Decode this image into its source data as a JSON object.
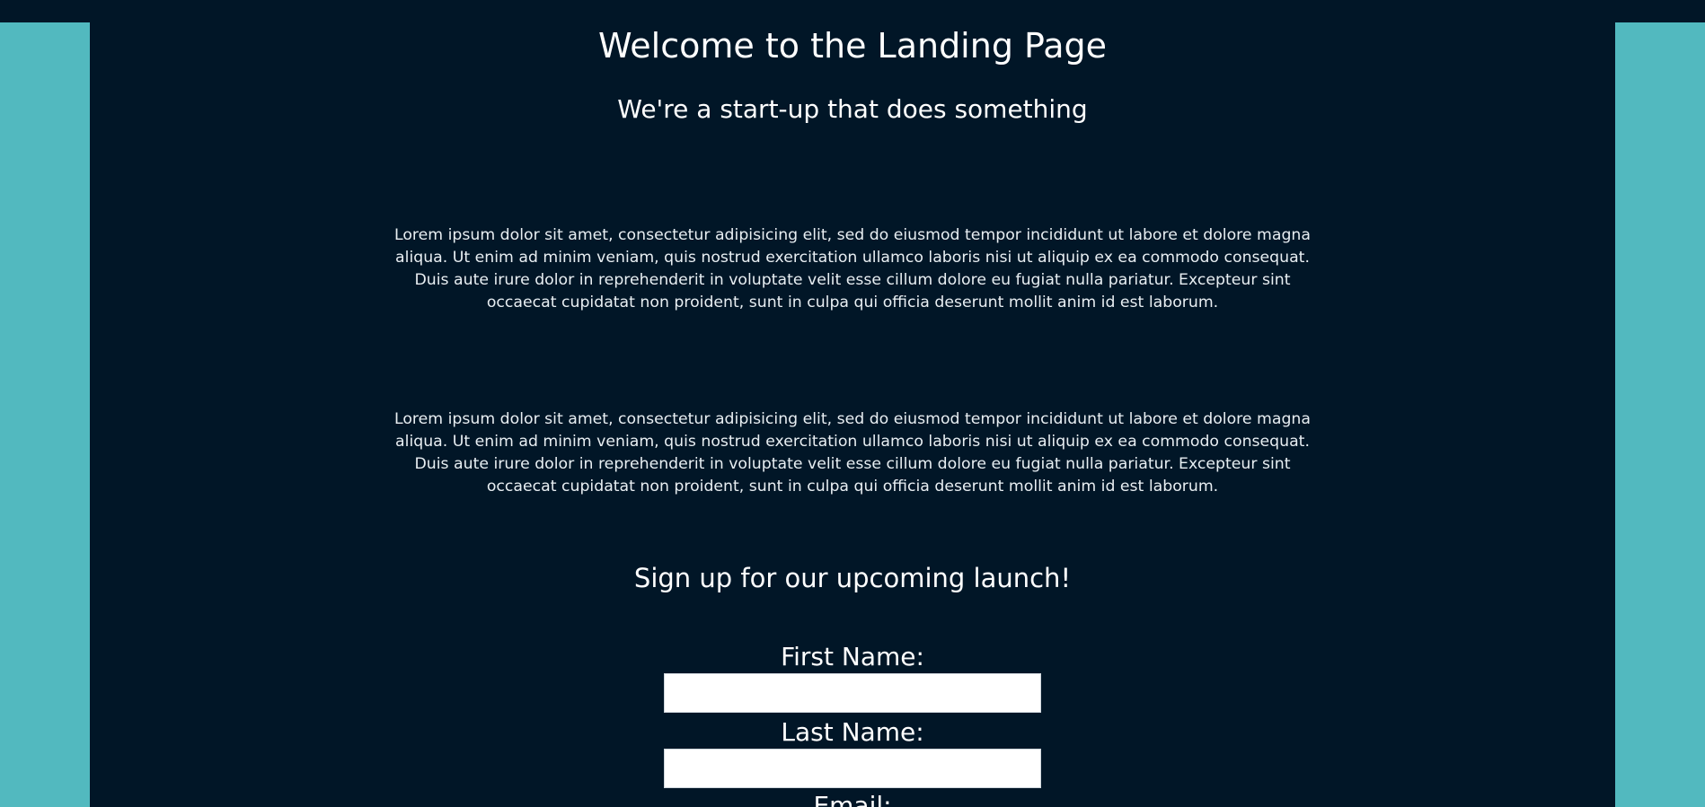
{
  "colors": {
    "background": "#011627",
    "side_panels": "#52b9bf",
    "text": "#ffffff"
  },
  "header": {
    "title": "Welcome to the Landing Page",
    "tagline": "We're a start-up that does something"
  },
  "main": {
    "paragraphs": [
      "Lorem ipsum dolor sit amet, consectetur adipisicing elit, sed do eiusmod tempor incididunt ut labore et dolore magna aliqua. Ut enim ad minim veniam, quis nostrud exercitation ullamco laboris nisi ut aliquip ex ea commodo consequat. Duis aute irure dolor in reprehenderit in voluptate velit esse cillum dolore eu fugiat nulla pariatur. Excepteur sint occaecat cupidatat non proident, sunt in culpa qui officia deserunt mollit anim id est laborum.",
      "Lorem ipsum dolor sit amet, consectetur adipisicing elit, sed do eiusmod tempor incididunt ut labore et dolore magna aliqua. Ut enim ad minim veniam, quis nostrud exercitation ullamco laboris nisi ut aliquip ex ea commodo consequat. Duis aute irure dolor in reprehenderit in voluptate velit esse cillum dolore eu fugiat nulla pariatur. Excepteur sint occaecat cupidatat non proident, sunt in culpa qui officia deserunt mollit anim id est laborum."
    ]
  },
  "signup": {
    "heading": "Sign up for our upcoming launch!",
    "fields": [
      {
        "label": "First Name:",
        "value": ""
      },
      {
        "label": "Last Name:",
        "value": ""
      },
      {
        "label": "Email:"
      }
    ]
  }
}
